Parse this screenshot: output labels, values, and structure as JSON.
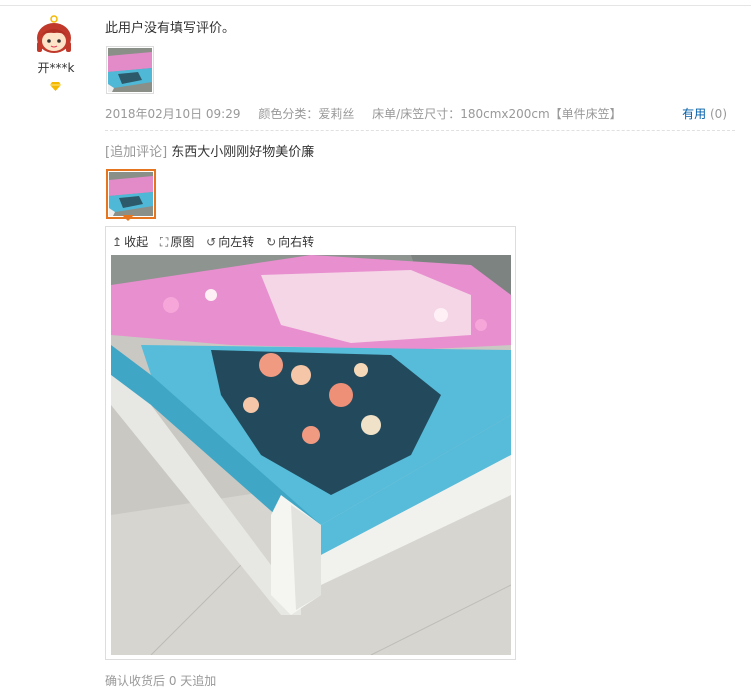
{
  "user": {
    "name": "开***k",
    "avatar_icon": "cartoon-girl-avatar-icon",
    "badge_icon": "diamond-icon",
    "badge_color": "#f5b800"
  },
  "review": {
    "text": "此用户没有填写评价。",
    "date": "2018年02月10日 09:29",
    "color": "颜色分类：爱莉丝",
    "size": "床单/床笠尺寸：180cmx200cm【单件床笠】",
    "useful_label": "有用",
    "useful_count": "(0)"
  },
  "append": {
    "label": "[追加评论]",
    "text": "东西大小刚刚好物美价廉"
  },
  "viewer": {
    "collapse": "收起",
    "original": "原图",
    "rotate_left": "向左转",
    "rotate_right": "向右转"
  },
  "footer": {
    "note": "确认收货后 0 天追加"
  },
  "colors": {
    "accent_orange": "#e5761f",
    "link_blue": "#005ea7",
    "muted": "#999999"
  }
}
